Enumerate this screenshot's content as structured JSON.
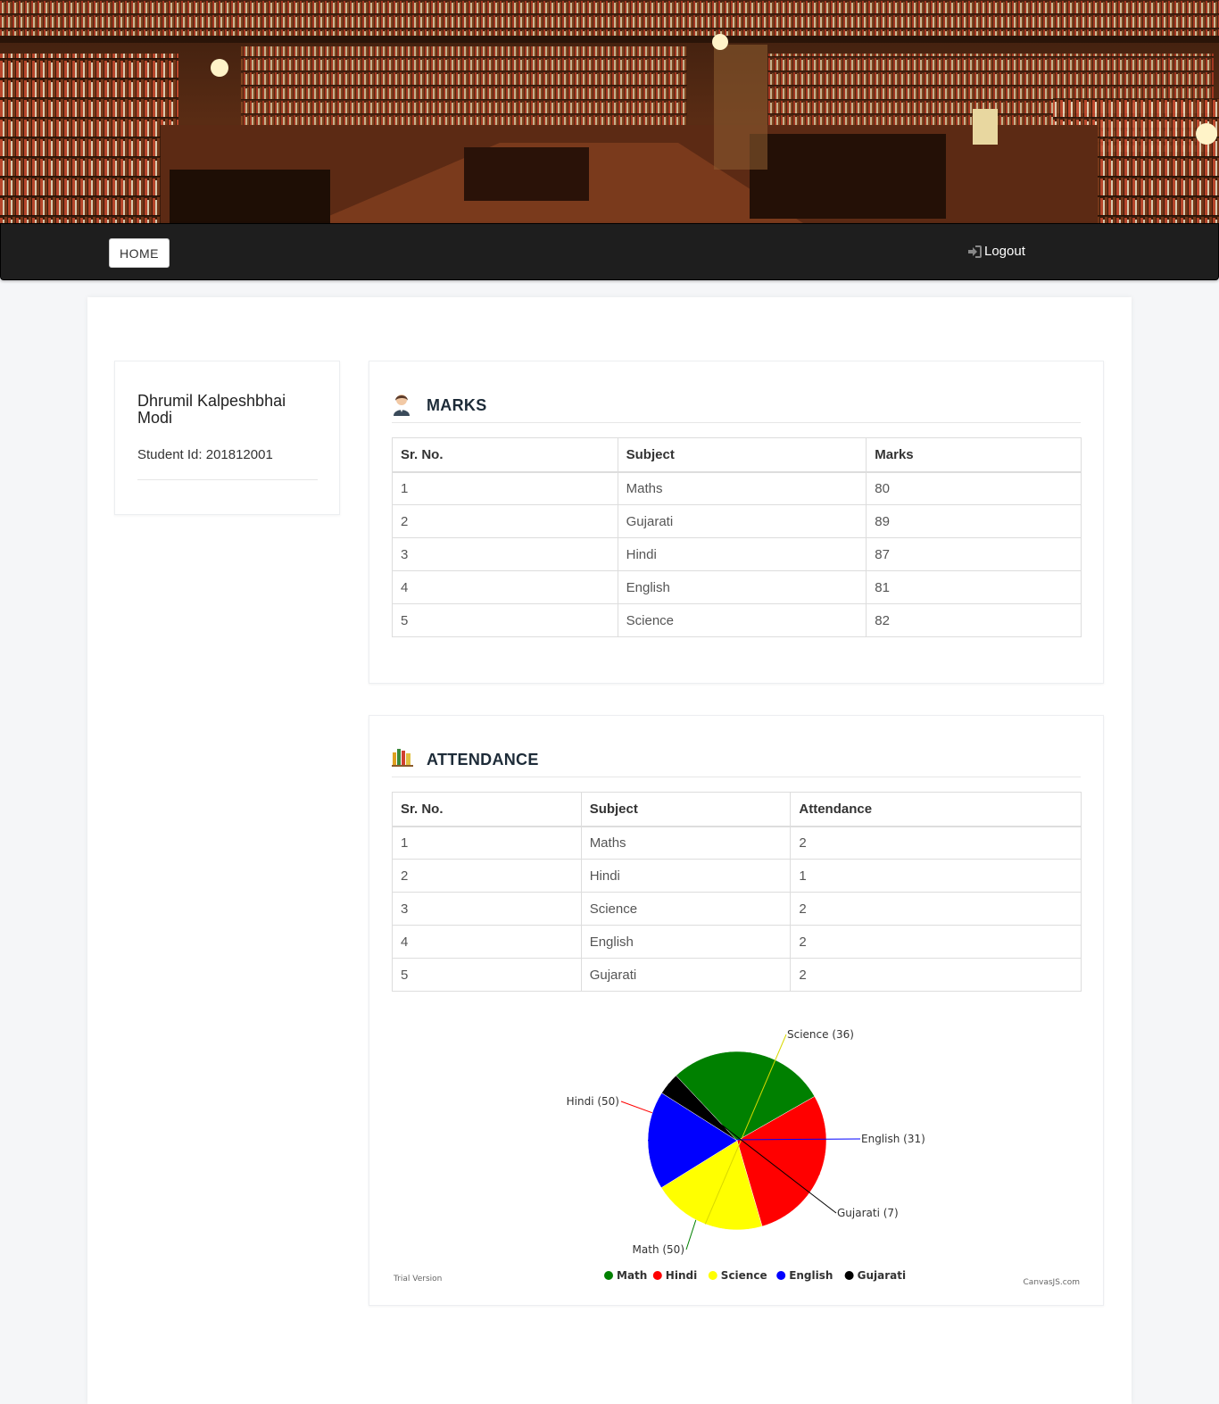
{
  "nav": {
    "home_label": "HOME",
    "logout_label": "Logout"
  },
  "profile": {
    "name": "Dhrumil Kalpeshbhai Modi",
    "student_id": "Student Id: 201812001"
  },
  "marks": {
    "title": "MARKS",
    "headers": [
      "Sr. No.",
      "Subject",
      "Marks"
    ],
    "rows": [
      [
        "1",
        "Maths",
        "80"
      ],
      [
        "2",
        "Gujarati",
        "89"
      ],
      [
        "3",
        "Hindi",
        "87"
      ],
      [
        "4",
        "English",
        "81"
      ],
      [
        "5",
        "Science",
        "82"
      ]
    ]
  },
  "attendance": {
    "title": "ATTENDANCE",
    "headers": [
      "Sr. No.",
      "Subject",
      "Attendance"
    ],
    "rows": [
      [
        "1",
        "Maths",
        "2"
      ],
      [
        "2",
        "Hindi",
        "1"
      ],
      [
        "3",
        "Science",
        "2"
      ],
      [
        "4",
        "English",
        "2"
      ],
      [
        "5",
        "Gujarati",
        "2"
      ]
    ]
  },
  "chart_data": {
    "type": "pie",
    "slices": [
      {
        "name": "Math",
        "value": 50,
        "label": "Math (50)",
        "color": "#008000"
      },
      {
        "name": "Hindi",
        "value": 50,
        "label": "Hindi (50)",
        "color": "#ff0000"
      },
      {
        "name": "Science",
        "value": 36,
        "label": "Science (36)",
        "color": "#ffff00"
      },
      {
        "name": "English",
        "value": 31,
        "label": "English (31)",
        "color": "#0000ff"
      },
      {
        "name": "Gujarati",
        "value": 7,
        "label": "Gujarati (7)",
        "color": "#000000"
      }
    ],
    "legend": [
      "Math",
      "Hindi",
      "Science",
      "English",
      "Gujarati"
    ],
    "legend_position": "bottom",
    "watermark_left": "Trial Version",
    "watermark_right": "CanvasJS.com"
  },
  "icons": {
    "marks_icon": "student-icon",
    "attendance_icon": "books-icon",
    "logout_icon": "sign-in-icon"
  }
}
